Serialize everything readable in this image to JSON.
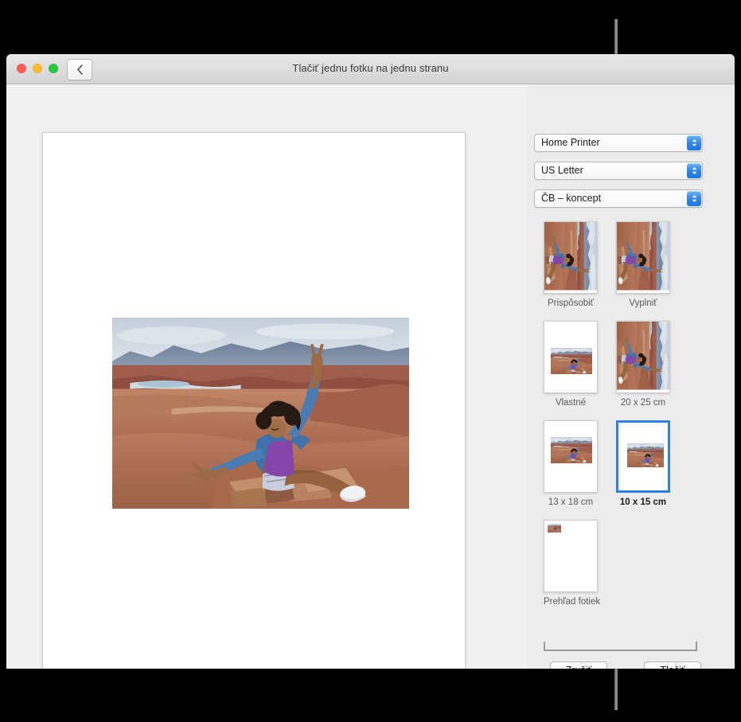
{
  "window": {
    "title": "Tlačiť jednu fotku na jednu stranu",
    "back_icon": "chevron-left-icon",
    "traffic_lights": {
      "close": "close-button",
      "minimize": "minimize-button",
      "zoom": "zoom-button",
      "close_color": "#ff5f57",
      "minimize_color": "#febc2e",
      "zoom_color": "#28c840"
    }
  },
  "popups": [
    {
      "name": "printer",
      "value": "Home Printer"
    },
    {
      "name": "paper",
      "value": "US Letter"
    },
    {
      "name": "quality",
      "value": "ČB – koncept"
    }
  ],
  "layouts": [
    {
      "id": "fit",
      "label": "Prispôsobiť",
      "selected": false
    },
    {
      "id": "fill",
      "label": "Vyplniť",
      "selected": false
    },
    {
      "id": "custom",
      "label": "Vlastné",
      "selected": false
    },
    {
      "id": "20x25",
      "label": "20 x 25 cm",
      "selected": false
    },
    {
      "id": "13x18",
      "label": "13 x 18 cm",
      "selected": false
    },
    {
      "id": "10x15",
      "label": "10 x 15 cm",
      "selected": true
    },
    {
      "id": "contact",
      "label": "Prehľad fotiek",
      "selected": false
    }
  ],
  "buttons": {
    "cancel": "Zrušiť",
    "print": "Tlačiť"
  },
  "colors": {
    "selection_blue": "#2e7fe8",
    "panel_background": "#ececec",
    "window_background": "#f0f0f0",
    "callout_line": "#8c8c8c"
  },
  "preview": {
    "photo_alt": "woman-on-canyon-overlook-photo"
  }
}
